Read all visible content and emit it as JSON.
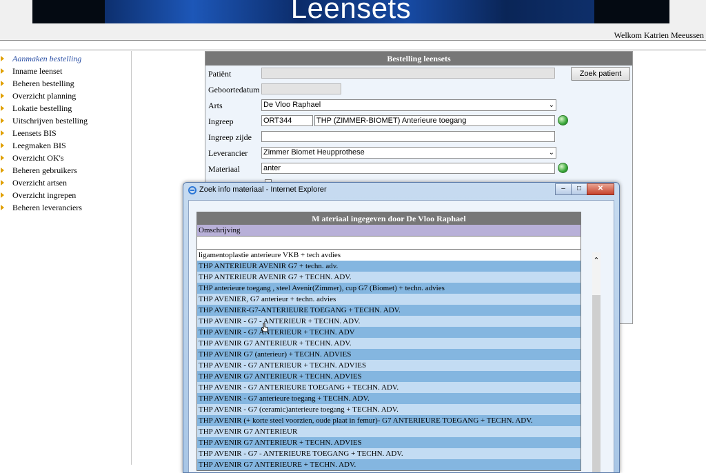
{
  "header": {
    "banner_title": "Leensets",
    "welcome": "Welkom Katrien Meeussen"
  },
  "sidebar": {
    "items": [
      {
        "label": "Aanmaken bestelling",
        "active": true
      },
      {
        "label": "Inname leenset"
      },
      {
        "label": "Beheren bestelling"
      },
      {
        "label": "Overzicht planning"
      },
      {
        "label": "Lokatie bestelling"
      },
      {
        "label": "Uitschrijven bestelling"
      },
      {
        "label": "Leensets BIS"
      },
      {
        "label": "Leegmaken BIS"
      },
      {
        "label": "Overzicht OK's"
      },
      {
        "label": "Beheren gebruikers"
      },
      {
        "label": "Overzicht artsen"
      },
      {
        "label": "Overzicht ingrepen"
      },
      {
        "label": "Beheren leveranciers"
      }
    ]
  },
  "form": {
    "title": "Bestelling leensets",
    "patient_label": "Patiënt",
    "patient_value": "",
    "find_patient_button": "Zoek patient",
    "birthdate_label": "Geboortedatum",
    "birthdate_value": "",
    "doctor_label": "Arts",
    "doctor_value": "De Vloo Raphael",
    "procedure_label": "Ingreep",
    "procedure_code": "ORT344",
    "procedure_desc": "THP (ZIMMER-BIOMET) Anterieure toegang",
    "procedure_side_label": "Ingreep zijde",
    "procedure_side_value": "",
    "supplier_label": "Leverancier",
    "supplier_value": "Zimmer Biomet Heupprothese",
    "material_label": "Materiaal",
    "material_value": "anter"
  },
  "popup": {
    "window_title": "Zoek info materiaal - Internet Explorer",
    "table_title": "M ateriaal ingegeven door De Vloo Raphael",
    "column_header": "Omschrijving",
    "rows": [
      "ligamentoplastie anterieure VKB + tech avdies",
      "THP ANTERIEUR AVENIR G7 + techn. adv.",
      "THP ANTERIEUR AVENIR G7 + TECHN. ADV.",
      "THP anterieure toegang , steel Avenir(Zimmer), cup G7 (Biomet) + techn. advies",
      "THP AVENIER, G7 anterieur + techn. advies",
      "THP AVENIER-G7-ANTERIEURE TOEGANG + TECHN. ADV.",
      "THP AVENIR - G7 - ANTERIEUR + TECHN. ADV.",
      "THP AVENIR - G7 ANTERIEUR + TECHN. ADV",
      "THP AVENIR G7 ANTERIEUR + TECHN. ADV.",
      "THP AVENIR G7 (anterieur) + TECHN. ADVIES",
      "THP AVENIR - G7 ANTERIEUR + TECHN. ADVIES",
      "THP AVENIR G7 ANTERIEUR + TECHN. ADVIES",
      "THP AVENIR - G7 ANTERIEURE TOEGANG + TECHN. ADV.",
      "THP AVENIR - G7 anterieure toegang + TECHN. ADV.",
      "THP AVENIR - G7 (ceramic)anterieure toegang + TECHN. ADV.",
      "THP AVENIR (+ korte steel voorzien, oude plaat in femur)- G7 ANTERIEURE TOEGANG + TECHN. ADV.",
      "THP AVENIR G7 ANTERIEUR",
      "THP AVENIR G7 ANTERIEUR + TECHN. ADVIES",
      "THP AVENIR - G7 - ANTERIEURE TOEGANG + TECHN. ADV.",
      "THP AVENIR G7 ANTERIEURE + TECHN. ADV."
    ],
    "colors": {
      "row_light": "#c3dcf3",
      "row_dark": "#84b6e0",
      "header": "#777777",
      "column_header": "#b8b0d8"
    }
  }
}
